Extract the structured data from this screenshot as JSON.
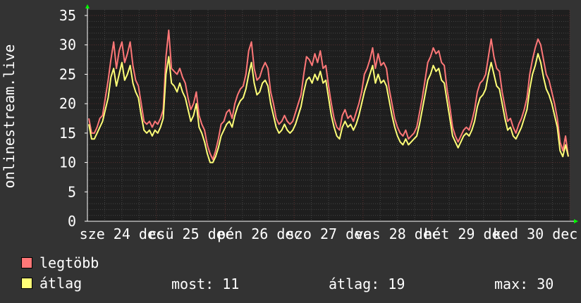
{
  "chart_data": {
    "type": "line",
    "ylabel": "onlinestream.live",
    "ylim": [
      0,
      35
    ],
    "yticks": [
      0,
      5,
      10,
      15,
      20,
      25,
      30,
      35
    ],
    "xtick_labels": [
      "sze 24 dec",
      "csü 25 dec",
      "pén 26 dec",
      "szo 27 dec",
      "vas 28 dec",
      "hét 29 dec",
      "ked 30 dec"
    ],
    "grid": true,
    "series": [
      {
        "name": "legtöbb",
        "color": "#ff7777",
        "values": [
          17.5,
          15.0,
          15.0,
          16.0,
          17.5,
          18.0,
          21.0,
          24.0,
          27.5,
          30.5,
          26.0,
          29.0,
          30.5,
          27.0,
          28.5,
          30.5,
          26.5,
          24.0,
          23.0,
          20.0,
          17.0,
          16.5,
          17.0,
          16.0,
          17.0,
          16.5,
          17.5,
          19.0,
          28.0,
          32.5,
          26.0,
          25.5,
          25.0,
          26.0,
          24.5,
          23.5,
          21.0,
          19.0,
          20.0,
          22.0,
          18.0,
          16.5,
          15.5,
          13.0,
          11.5,
          10.5,
          12.0,
          14.0,
          16.5,
          17.0,
          18.5,
          19.0,
          17.5,
          20.0,
          21.5,
          22.5,
          23.0,
          25.0,
          29.0,
          30.5,
          26.0,
          24.0,
          24.5,
          26.0,
          27.0,
          26.0,
          22.0,
          20.0,
          17.5,
          16.5,
          17.0,
          18.0,
          17.0,
          16.5,
          17.0,
          18.5,
          20.0,
          21.5,
          25.0,
          28.0,
          27.5,
          26.5,
          28.5,
          27.0,
          29.0,
          26.0,
          26.5,
          23.0,
          20.0,
          17.5,
          16.0,
          15.5,
          18.0,
          19.0,
          17.5,
          18.0,
          17.0,
          18.5,
          20.0,
          22.0,
          25.0,
          26.0,
          27.5,
          29.5,
          26.0,
          28.5,
          26.5,
          27.0,
          26.0,
          22.5,
          20.0,
          17.5,
          16.0,
          15.0,
          14.5,
          15.5,
          14.0,
          14.5,
          15.0,
          16.0,
          18.5,
          21.0,
          24.0,
          27.0,
          28.0,
          29.5,
          28.5,
          29.0,
          27.0,
          26.5,
          22.5,
          19.5,
          16.0,
          14.5,
          13.5,
          14.5,
          15.5,
          16.0,
          15.5,
          17.0,
          19.0,
          22.0,
          23.5,
          24.0,
          25.0,
          28.0,
          31.0,
          28.0,
          26.0,
          25.5,
          22.0,
          19.5,
          17.0,
          17.5,
          16.0,
          15.0,
          16.5,
          17.5,
          19.0,
          21.0,
          25.0,
          27.5,
          29.5,
          31.0,
          30.0,
          27.5,
          25.0,
          24.0,
          22.0,
          20.0,
          17.5,
          13.5,
          12.0,
          14.5,
          11.0
        ]
      },
      {
        "name": "átlag",
        "color": "#ffff77",
        "values": [
          16.5,
          14.0,
          14.0,
          15.0,
          16.0,
          17.0,
          19.0,
          21.0,
          24.5,
          26.0,
          23.0,
          25.0,
          27.0,
          24.0,
          25.0,
          26.5,
          23.5,
          22.0,
          21.0,
          18.0,
          15.5,
          15.0,
          15.5,
          14.5,
          15.5,
          15.0,
          16.0,
          17.5,
          25.0,
          28.0,
          23.5,
          23.0,
          22.0,
          23.5,
          22.0,
          21.0,
          19.0,
          17.0,
          18.0,
          20.0,
          16.0,
          15.0,
          13.5,
          11.5,
          10.0,
          10.0,
          11.0,
          12.5,
          14.5,
          15.5,
          16.5,
          17.0,
          16.0,
          18.0,
          19.5,
          20.5,
          21.0,
          22.5,
          25.0,
          27.0,
          23.5,
          21.5,
          22.0,
          23.5,
          24.0,
          23.0,
          20.0,
          18.0,
          16.0,
          15.0,
          15.5,
          16.5,
          15.5,
          15.0,
          15.5,
          16.5,
          18.0,
          19.5,
          22.0,
          24.0,
          24.5,
          23.5,
          25.0,
          24.0,
          25.5,
          23.5,
          24.0,
          21.0,
          18.0,
          16.0,
          14.5,
          14.0,
          16.0,
          17.0,
          16.0,
          16.5,
          15.5,
          16.5,
          18.0,
          20.0,
          22.0,
          23.5,
          25.0,
          26.5,
          23.5,
          25.0,
          23.5,
          24.0,
          23.0,
          20.5,
          18.0,
          16.0,
          14.5,
          13.5,
          13.0,
          14.0,
          13.0,
          13.5,
          14.0,
          14.5,
          16.5,
          19.0,
          21.5,
          24.0,
          25.0,
          26.5,
          25.5,
          26.0,
          24.0,
          23.5,
          20.5,
          17.5,
          14.5,
          13.5,
          12.5,
          13.5,
          14.5,
          15.0,
          14.5,
          15.5,
          17.0,
          19.5,
          21.0,
          21.5,
          22.5,
          25.0,
          27.0,
          25.0,
          23.0,
          22.5,
          20.0,
          17.5,
          15.5,
          16.0,
          14.5,
          14.0,
          15.0,
          16.0,
          17.5,
          19.0,
          22.5,
          25.0,
          26.5,
          28.5,
          27.0,
          24.5,
          22.5,
          21.5,
          20.0,
          18.0,
          16.0,
          12.0,
          11.0,
          13.0,
          11.0
        ]
      }
    ],
    "legend": {
      "placement": "bottom-left",
      "items": [
        {
          "label": "legtöbb",
          "color": "#ff7777"
        },
        {
          "label": "átlag",
          "color": "#ffff77"
        }
      ]
    },
    "stats": {
      "most": "most: 11",
      "atlag": "átlag: 19",
      "max": "max: 30"
    }
  },
  "colors": {
    "background": "#333333",
    "plot_background": "#1e1e1e",
    "major_grid": "#5a3030",
    "minor_grid": "#444444",
    "axis": "#ffffff",
    "arrow": "#00ff00"
  }
}
